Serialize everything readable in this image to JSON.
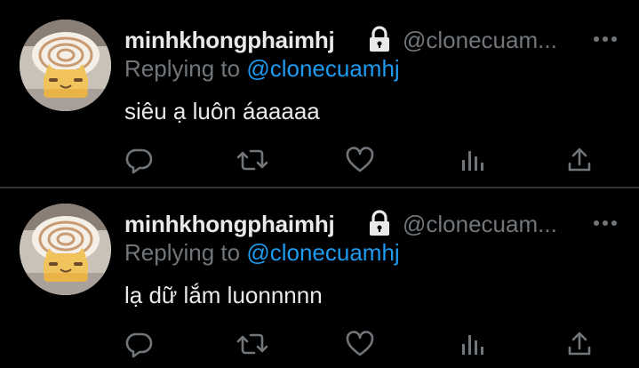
{
  "colors": {
    "background": "#000000",
    "name": "#e7e9ea",
    "muted": "#71767b",
    "link": "#1d9bf0",
    "divider": "#2f3336"
  },
  "tweets": [
    {
      "display_name": "minhkhongphaimhj",
      "handle": "@clonecuam...",
      "replying_prefix": "Replying to",
      "replying_to": "@clonecuamhj",
      "text": "siêu ạ luôn áaaaaa",
      "icons": [
        "lock-icon",
        "more-icon",
        "reply-icon",
        "retweet-icon",
        "like-icon",
        "views-icon",
        "share-icon"
      ]
    },
    {
      "display_name": "minhkhongphaimhj",
      "handle": "@clonecuam...",
      "replying_prefix": "Replying to",
      "replying_to": "@clonecuamhj",
      "text": "lạ dữ lắm luonnnnn",
      "icons": [
        "lock-icon",
        "more-icon",
        "reply-icon",
        "retweet-icon",
        "like-icon",
        "views-icon",
        "share-icon"
      ]
    }
  ]
}
